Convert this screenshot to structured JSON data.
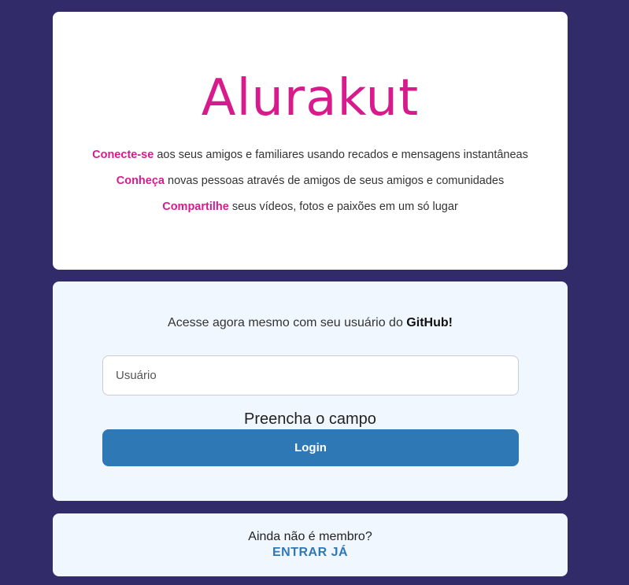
{
  "brand": {
    "logo_text": "Alurakut",
    "accent_color": "#d81b8c"
  },
  "features": [
    {
      "highlight": "Conecte-se",
      "text": " aos seus amigos e familiares usando recados e mensagens instantâneas"
    },
    {
      "highlight": "Conheça",
      "text": " novas pessoas através de amigos de seus amigos e comunidades"
    },
    {
      "highlight": "Compartilhe",
      "text": " seus vídeos, fotos e paixões em um só lugar"
    }
  ],
  "login": {
    "prompt_prefix": "Acesse agora mesmo com seu usuário do ",
    "prompt_strong": "GitHub",
    "prompt_suffix": "!",
    "username_placeholder": "Usuário",
    "username_value": "",
    "validation_message": "Preencha o campo",
    "button_label": "Login",
    "button_color": "#2e78b5"
  },
  "signup": {
    "question": "Ainda não é membro?",
    "link_label": "ENTRAR JÁ"
  },
  "colors": {
    "page_background": "#312c69",
    "card_light": "#f1f7fe"
  }
}
